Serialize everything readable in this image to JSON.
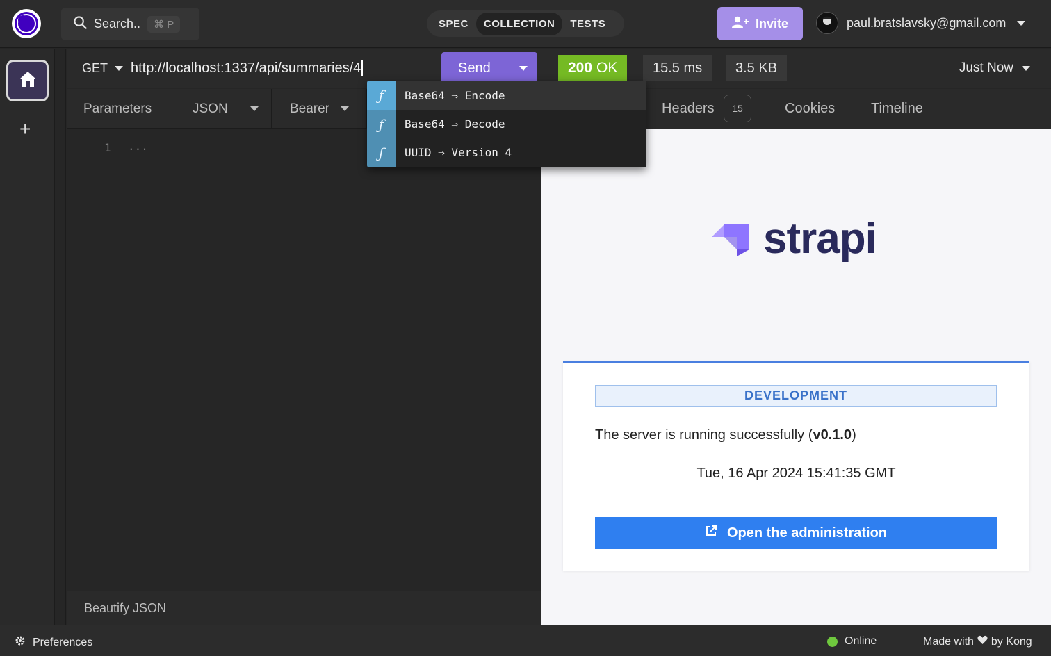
{
  "topbar": {
    "search_label": "Search..",
    "search_shortcut": "⌘ P",
    "tabs": [
      {
        "label": "SPEC"
      },
      {
        "label": "COLLECTION"
      },
      {
        "label": "TESTS"
      }
    ],
    "active_tab": "COLLECTION",
    "invite_label": "Invite",
    "user_email": "paul.bratslavsky@gmail.com"
  },
  "request": {
    "method": "GET",
    "url": "http://localhost:1337/api/summaries/4",
    "send_label": "Send",
    "tabs": [
      {
        "label": "Parameters"
      },
      {
        "label": "JSON"
      },
      {
        "label": "Bearer"
      }
    ],
    "editor_line": "1",
    "editor_fold": "...",
    "beautify_label": "Beautify JSON"
  },
  "autocomplete": {
    "items": [
      {
        "icon": "ƒ",
        "label": "Base64 ⇒ Encode"
      },
      {
        "icon": "ƒ",
        "label": "Base64 ⇒ Decode"
      },
      {
        "icon": "ƒ",
        "label": "UUID ⇒ Version 4"
      }
    ]
  },
  "response": {
    "status_code": "200",
    "status_text": "OK",
    "time": "15.5 ms",
    "size": "3.5 KB",
    "timestamp": "Just Now",
    "tabs": {
      "headers": "Headers",
      "headers_count": "15",
      "cookies": "Cookies",
      "timeline": "Timeline"
    }
  },
  "preview": {
    "brand": "strapi",
    "env_badge": "DEVELOPMENT",
    "running_text": "The server is running successfully (",
    "version": "v0.1.0",
    "running_close": ")",
    "date": "Tue, 16 Apr 2024 15:41:35 GMT",
    "admin_button": "Open the administration"
  },
  "statusbar": {
    "preferences": "Preferences",
    "online": "Online",
    "made_with": "Made with",
    "by_kong": "by Kong"
  },
  "colors": {
    "accent": "#7d65d6",
    "status_ok": "#75ba24",
    "strapi_blue": "#2f7ff0",
    "online_green": "#6fc83e"
  }
}
